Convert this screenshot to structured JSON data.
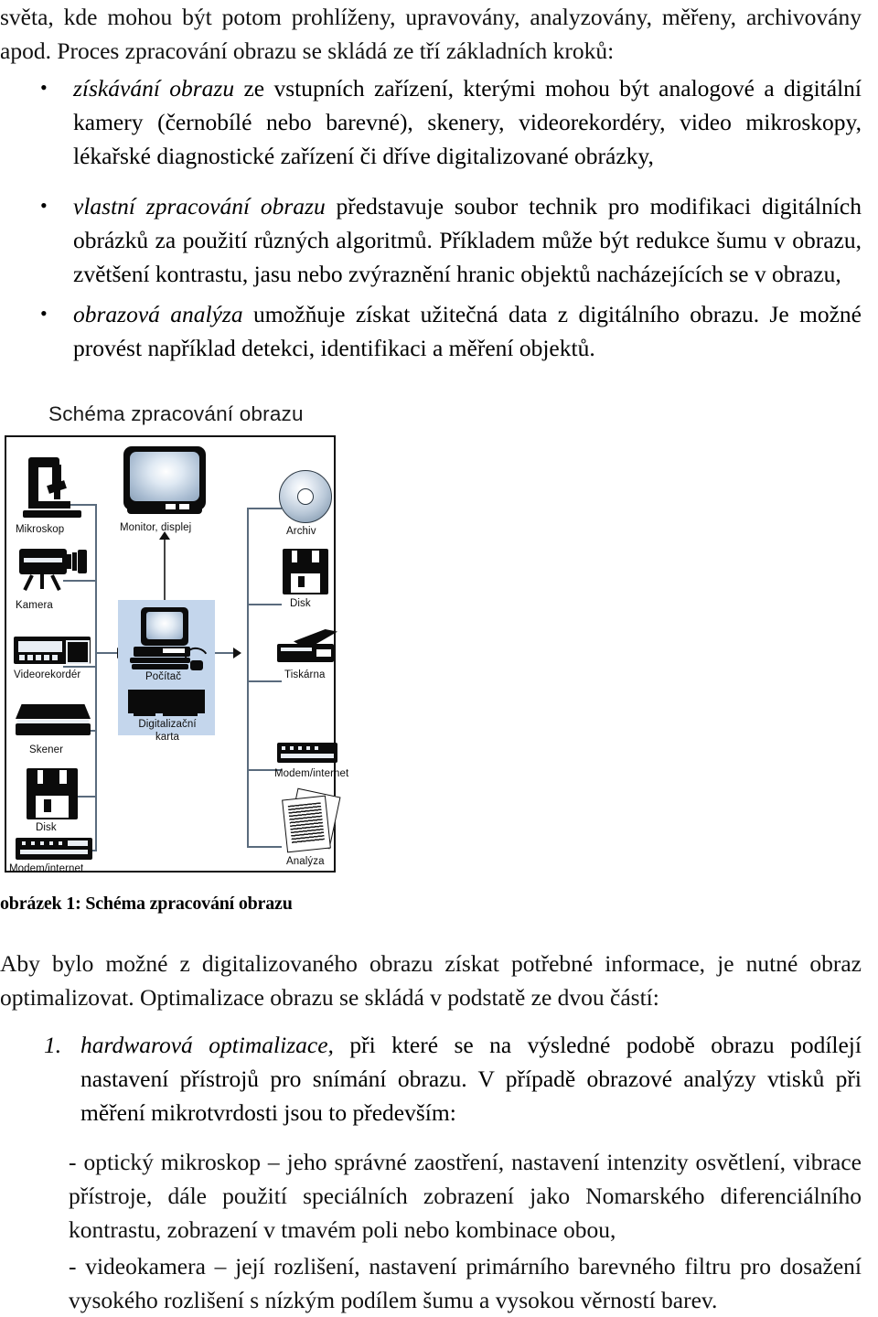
{
  "document": {
    "language": "cs",
    "top_paragraph": {
      "line1": "světa, kde mohou být potom prohlíženy, upravovány, analyzovány, měřeny, archivovány",
      "line2_prefix": "apod. ",
      "line2_rest": "Proces zpracování obrazu se skládá ze tří základních kroků:"
    },
    "bullets": [
      {
        "marker": "•",
        "emphasis": "získávání obrazu",
        "text": " ze vstupních zařízení, kterými mohou být analogové a digitální kamery (černobílé nebo barevné), skenery, videorekordéry, video mikroskopy, lékařské diagnostické zařízení či dříve digitalizované obrázky,"
      },
      {
        "marker": "•",
        "emphasis": "vlastní zpracování obrazu",
        "text": " představuje soubor technik pro modifikaci digitálních obrázků za použití různých algoritmů. Příkladem může být redukce šumu v obrazu, zvětšení kontrastu, jasu nebo zvýraznění hranic objektů nacházejících se v obrazu,"
      },
      {
        "marker": "•",
        "emphasis": "obrazová analýza",
        "text": " umožňuje získat užitečná data z digitálního obrazu. Je možné provést například detekci, identifikaci a měření objektů."
      }
    ],
    "figure": {
      "title": "Schéma zpracování obrazu",
      "caption": "obrázek 1: Schéma zpracování obrazu",
      "inputs": [
        "Mikroskop",
        "Kamera",
        "Videorekordér",
        "Skener",
        "Disk",
        "Modem/internet"
      ],
      "processing": [
        "Počítač",
        "Digitalizační karta"
      ],
      "display": "Monitor, displej",
      "outputs": [
        "Archiv",
        "Disk",
        "Tiskárna",
        "Modem/internet",
        "Analýza"
      ],
      "labels": {
        "mikroskop": "Mikroskop",
        "kamera": "Kamera",
        "videorekorder": "Videorekordér",
        "skener": "Skener",
        "disk_left": "Disk",
        "modem_left": "Modem/internet",
        "monitor": "Monitor, displej",
        "pocitac": "Počítač",
        "karta_line1": "Digitalizační",
        "karta_line2": "karta",
        "archiv": "Archiv",
        "disk_right": "Disk",
        "tiskarna": "Tiskárna",
        "modem_right": "Modem/internet",
        "analyza": "Analýza"
      },
      "colors": {
        "processing_zone": "#c4d6ec",
        "wire": "#5a6b7d",
        "frame": "#111111",
        "icon": "#0b0b0b"
      }
    },
    "after_figure_paragraph": "Aby bylo možné z digitalizovaného obrazu získat potřebné informace, je nutné obraz optimalizovat. Optimalizace obrazu se skládá v podstatě ze dvou částí:",
    "numbered_list": [
      {
        "marker": "1.",
        "emphasis": "hardwarová optimalizace,",
        "text": " při které se na výsledné podobě obrazu podílejí nastavení přístrojů pro snímání obrazu. V případě obrazové analýzy vtisků při měření mikrotvrdosti jsou to především:"
      }
    ],
    "dash_paragraphs": [
      "- optický mikroskop – jeho správné zaostření, nastavení intenzity osvětlení, vibrace přístroje, dále použití speciálních zobrazení jako Nomarského diferenciálního kontrastu, zobrazení v tmavém poli nebo kombinace obou,",
      "- videokamera – její rozlišení, nastavení primárního barevného filtru pro dosažení vysokého rozlišení s nízkým podílem šumu a vysokou věrností barev."
    ]
  }
}
